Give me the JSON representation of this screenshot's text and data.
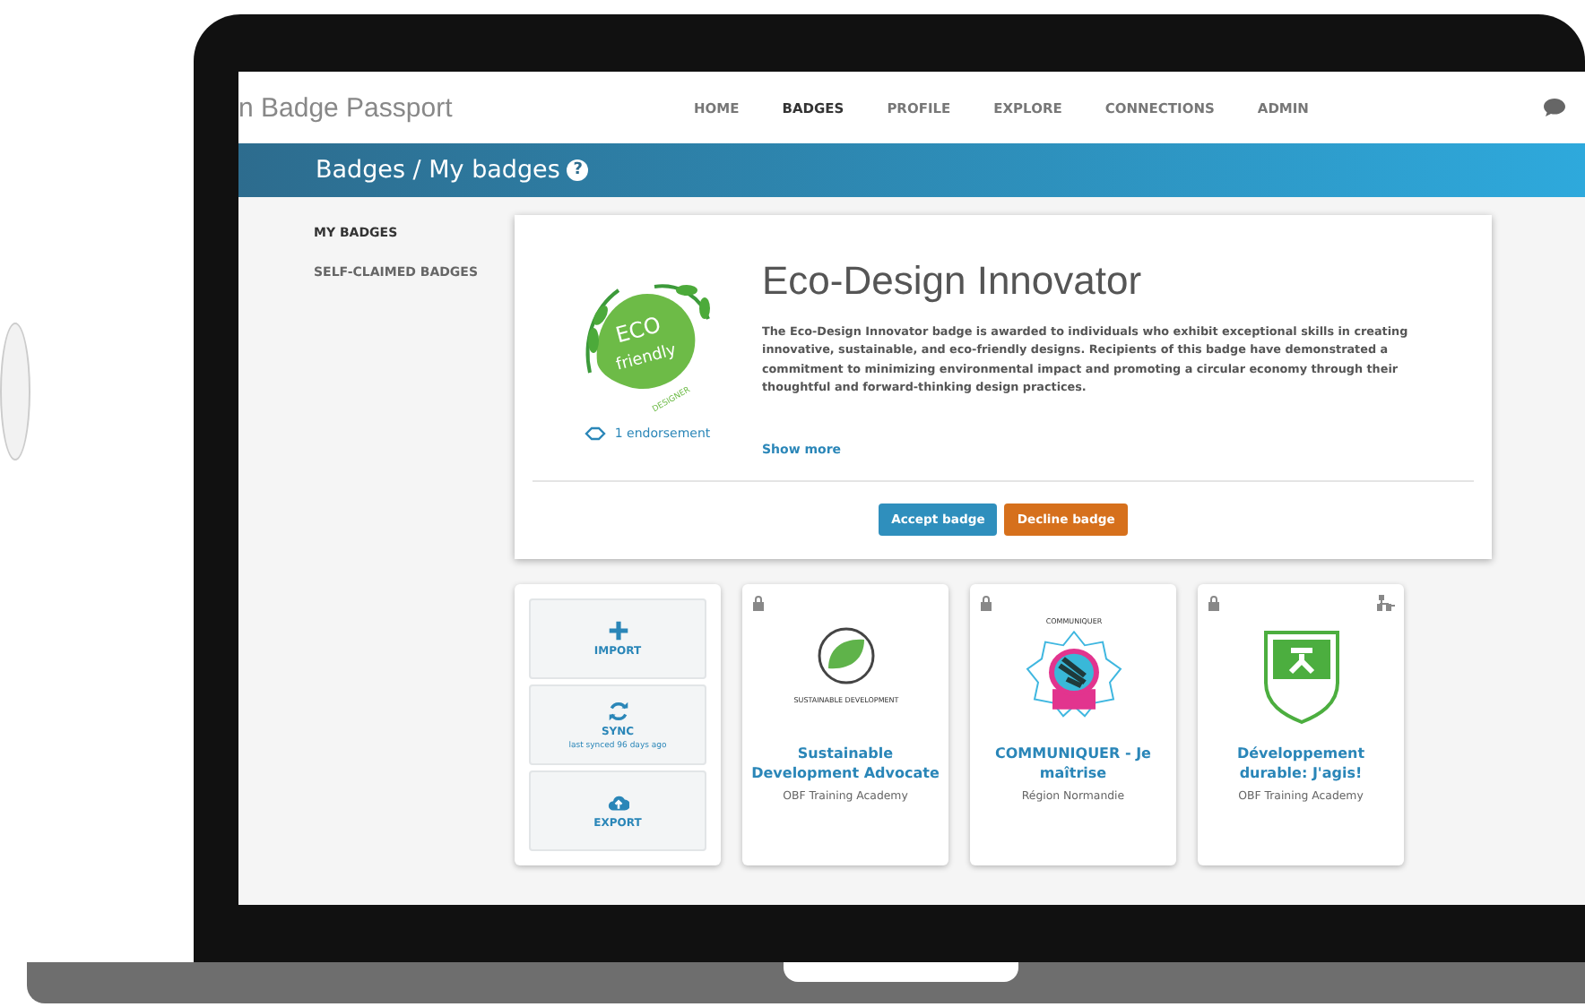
{
  "header": {
    "brand": "n Badge Passport",
    "nav": [
      {
        "label": "HOME",
        "selected": false
      },
      {
        "label": "BADGES",
        "selected": true
      },
      {
        "label": "PROFILE",
        "selected": false
      },
      {
        "label": "EXPLORE",
        "selected": false
      },
      {
        "label": "CONNECTIONS",
        "selected": false
      },
      {
        "label": "ADMIN",
        "selected": false
      }
    ]
  },
  "title_bar": {
    "title": "Badges / My badges",
    "help": "?"
  },
  "sidebar": {
    "items": [
      {
        "label": "MY BADGES",
        "selected": true
      },
      {
        "label": "SELF-CLAIMED BADGES",
        "selected": false
      }
    ]
  },
  "pending_badge": {
    "name": "Eco-Design Innovator",
    "description": "The Eco-Design Innovator badge is awarded to individuals who exhibit exceptional skills in creating innovative, sustainable, and eco-friendly designs. Recipients of this badge have demonstrated a commitment to minimizing environmental impact and promoting a circular economy through their thoughtful and forward-thinking design practices.",
    "image_text": [
      "ECO",
      "friendly",
      "DESIGNER"
    ],
    "endorsements": "1 endorsement",
    "show_more": "Show more",
    "buttons": [
      {
        "label": "Accept badge",
        "kind": "accept"
      },
      {
        "label": "Decline badge",
        "kind": "decline"
      }
    ]
  },
  "actions": [
    {
      "label": "IMPORT",
      "kind": "import"
    },
    {
      "label": "SYNC",
      "kind": "sync",
      "note": "last synced 96 days ago"
    },
    {
      "label": "EXPORT",
      "kind": "export"
    }
  ],
  "badges": [
    {
      "name": "Sustainable Development Advocate",
      "issuer": "OBF Training Academy",
      "kind": "leaf",
      "image_text": "SUSTAINABLE DEVELOPMENT",
      "locked": true,
      "shared": false
    },
    {
      "name": "COMMUNIQUER - Je maîtrise",
      "issuer": "Région Normandie",
      "kind": "star",
      "image_text": "COMMUNIQUER",
      "locked": true,
      "shared": false
    },
    {
      "name": "Développement durable: J'agis!",
      "issuer": "OBF Training Academy",
      "kind": "shield",
      "locked": true,
      "shared": true
    }
  ]
}
